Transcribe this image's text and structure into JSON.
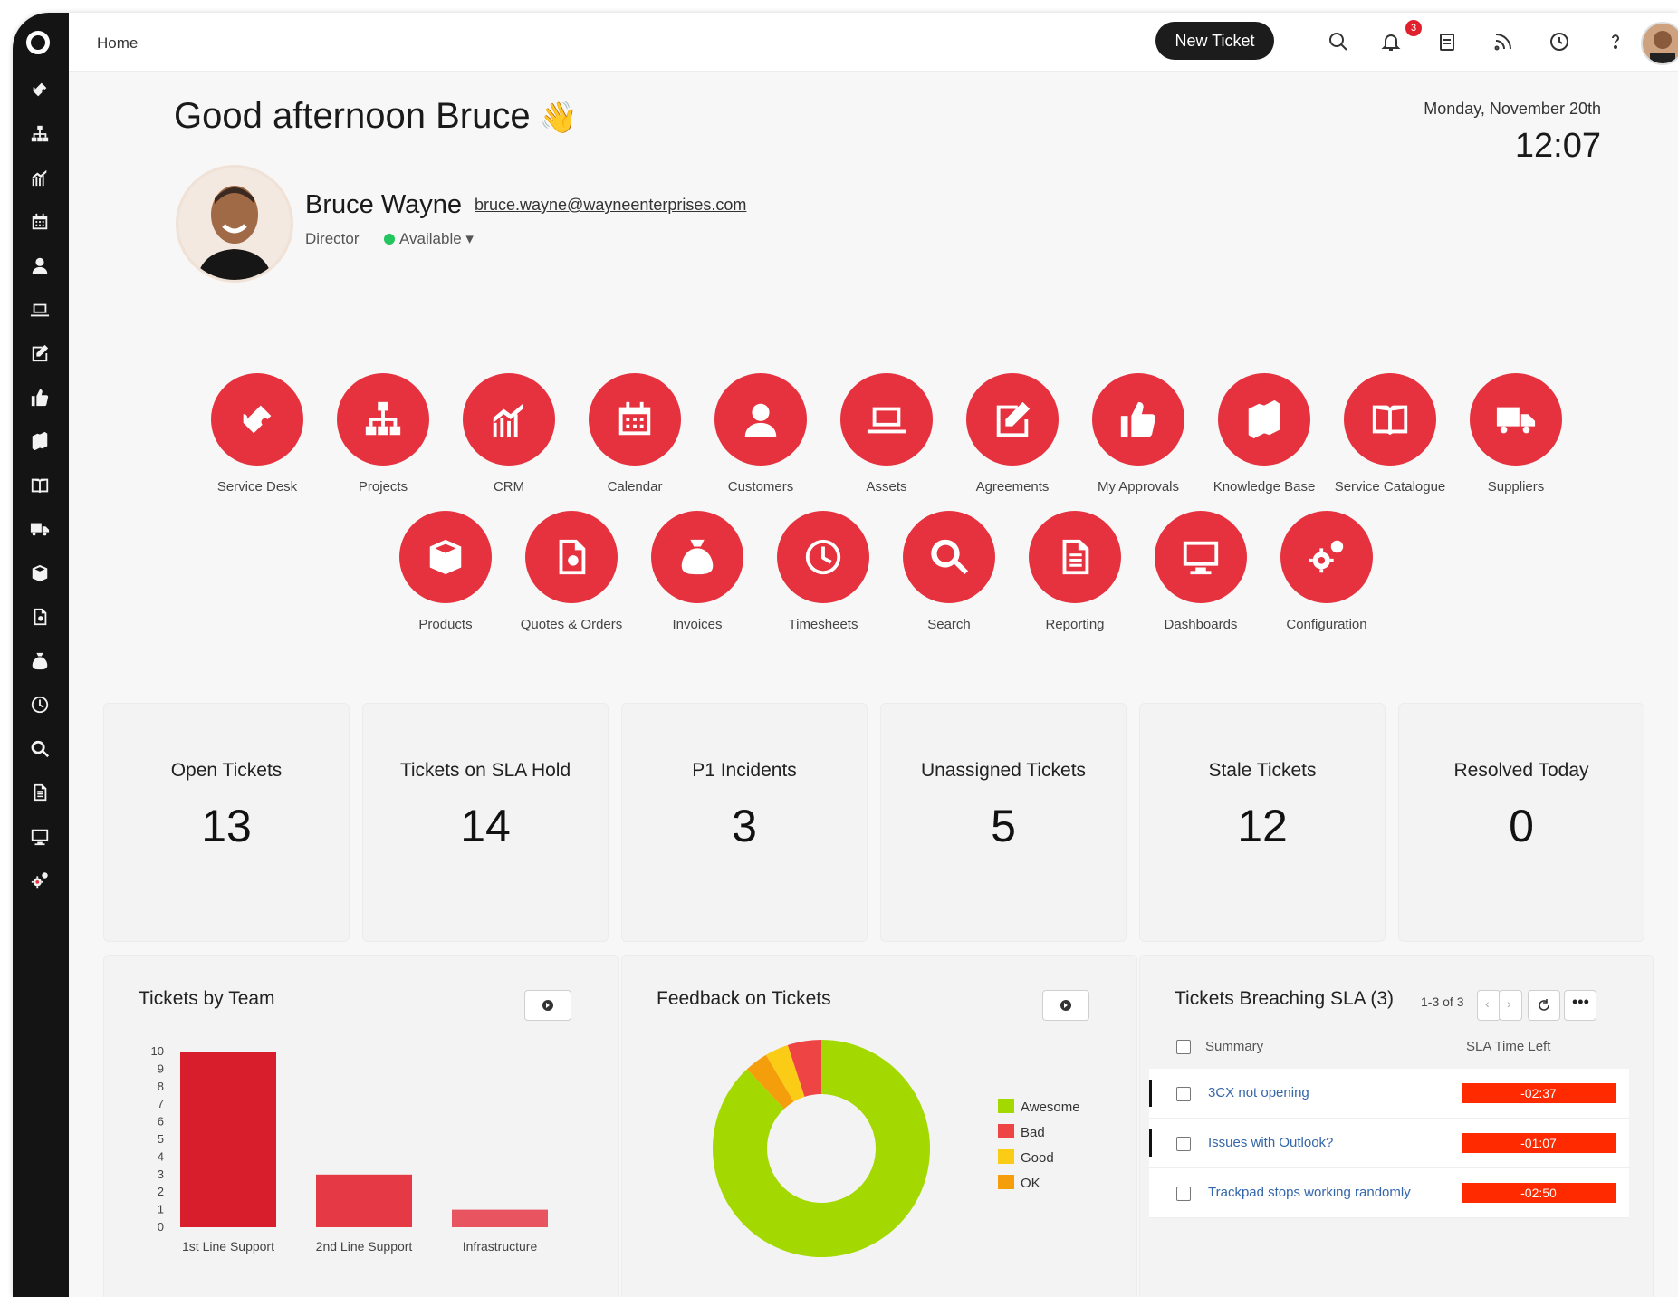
{
  "topbar": {
    "breadcrumb": "Home",
    "new_ticket_label": "New Ticket",
    "notification_count": "3",
    "icons": [
      "search-icon",
      "bell-icon",
      "clipboard-icon",
      "rss-icon",
      "clock-icon",
      "help-icon"
    ]
  },
  "sidebar": {
    "icons": [
      "ticket-icon",
      "sitemap-icon",
      "chart-icon",
      "calendar-icon",
      "user-icon",
      "laptop-icon",
      "edit-icon",
      "thumbs-up-icon",
      "books-icon",
      "book-icon",
      "truck-icon",
      "box-icon",
      "document-icon",
      "money-bag-icon",
      "clock-icon",
      "search-icon",
      "report-icon",
      "monitor-icon",
      "gears-icon"
    ]
  },
  "greeting": {
    "text": "Good afternoon Bruce",
    "emoji": "👋",
    "date": "Monday, November 20th",
    "time": "12:07"
  },
  "profile": {
    "name": "Bruce Wayne",
    "email": "bruce.wayne@wayneenterprises.com",
    "role": "Director",
    "status": "Available"
  },
  "tiles": [
    {
      "label": "Service Desk",
      "icon": "ticket-icon"
    },
    {
      "label": "Projects",
      "icon": "sitemap-icon"
    },
    {
      "label": "CRM",
      "icon": "chart-icon"
    },
    {
      "label": "Calendar",
      "icon": "calendar-icon"
    },
    {
      "label": "Customers",
      "icon": "user-icon"
    },
    {
      "label": "Assets",
      "icon": "laptop-icon"
    },
    {
      "label": "Agreements",
      "icon": "edit-icon"
    },
    {
      "label": "My Approvals",
      "icon": "thumbs-up-icon"
    },
    {
      "label": "Knowledge Base",
      "icon": "books-icon"
    },
    {
      "label": "Service Catalogue",
      "icon": "book-icon"
    },
    {
      "label": "Suppliers",
      "icon": "truck-icon"
    },
    {
      "label": "Products",
      "icon": "box-icon"
    },
    {
      "label": "Quotes & Orders",
      "icon": "document-search-icon"
    },
    {
      "label": "Invoices",
      "icon": "money-bag-icon"
    },
    {
      "label": "Timesheets",
      "icon": "clock-icon"
    },
    {
      "label": "Search",
      "icon": "search-icon"
    },
    {
      "label": "Reporting",
      "icon": "report-icon"
    },
    {
      "label": "Dashboards",
      "icon": "monitor-icon"
    },
    {
      "label": "Configuration",
      "icon": "gears-icon"
    }
  ],
  "stats": [
    {
      "title": "Open Tickets",
      "value": "13"
    },
    {
      "title": "Tickets on SLA Hold",
      "value": "14"
    },
    {
      "title": "P1 Incidents",
      "value": "3"
    },
    {
      "title": "Unassigned Tickets",
      "value": "5"
    },
    {
      "title": "Stale Tickets",
      "value": "12"
    },
    {
      "title": "Resolved Today",
      "value": "0"
    }
  ],
  "panels": {
    "team_title": "Tickets by Team",
    "feedback_title": "Feedback on Tickets",
    "sla_title": "Tickets Breaching SLA (3)",
    "sla_paging": "1-3 of 3",
    "sla_col_summary": "Summary",
    "sla_col_time": "SLA Time Left",
    "sla_rows": [
      {
        "summary": "3CX not opening",
        "time": "-02:37"
      },
      {
        "summary": "Issues with Outlook?",
        "time": "-01:07"
      },
      {
        "summary": "Trackpad stops working randomly",
        "time": "-02:50"
      }
    ]
  },
  "chart_data": [
    {
      "type": "bar",
      "title": "Tickets by Team",
      "categories": [
        "1st Line Support",
        "2nd Line Support",
        "Infrastructure"
      ],
      "values": [
        10,
        3,
        1
      ],
      "ylim": [
        0,
        10
      ],
      "yticks": [
        0,
        1,
        2,
        3,
        4,
        5,
        6,
        7,
        8,
        9,
        10
      ],
      "colors": [
        "#d81e2c",
        "#e63946",
        "#e85560"
      ]
    },
    {
      "type": "pie",
      "title": "Feedback on Tickets",
      "donut": true,
      "labels": [
        "Awesome",
        "Bad",
        "Good",
        "OK"
      ],
      "values": [
        88,
        5,
        3.5,
        3.5
      ],
      "colors": [
        "#a3d900",
        "#ef4444",
        "#facc15",
        "#f59e0b"
      ],
      "legend": "right"
    }
  ]
}
